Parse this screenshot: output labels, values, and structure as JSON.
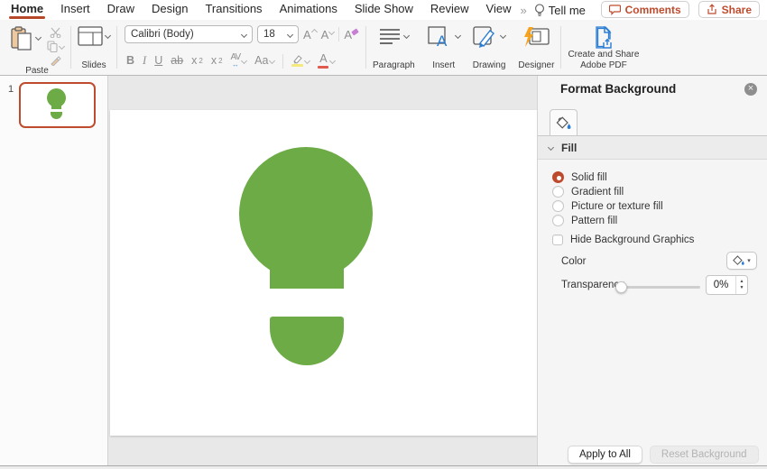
{
  "menubar": {
    "tabs": [
      "Home",
      "Insert",
      "Draw",
      "Design",
      "Transitions",
      "Animations",
      "Slide Show",
      "Review",
      "View"
    ],
    "overflow_glyph": "»",
    "tellme_label": "Tell me",
    "comments_label": "Comments",
    "share_label": "Share"
  },
  "ribbon": {
    "paste_label": "Paste",
    "slides_label": "Slides",
    "font_name": "Calibri (Body)",
    "font_size": "18",
    "increase_font": "A",
    "decrease_font": "A",
    "clear_format": "A",
    "bold": "B",
    "italic": "I",
    "underline": "U",
    "strikethrough": "ab",
    "superscript_base": "x",
    "superscript_mark": "2",
    "subscript_base": "x",
    "subscript_mark": "2",
    "char_spacing": "AV",
    "char_spacing_arrow": "↔",
    "change_case": "Aa",
    "font_color": "A",
    "paragraph_label": "Paragraph",
    "insert_label": "Insert",
    "drawing_label": "Drawing",
    "designer_label": "Designer",
    "adobe_label_line1": "Create and Share",
    "adobe_label_line2": "Adobe PDF"
  },
  "slides_panel": {
    "slide_number": "1"
  },
  "format_panel": {
    "title": "Format Background",
    "close_glyph": "×",
    "fill_section_label": "Fill",
    "fill_options": [
      "Solid fill",
      "Gradient fill",
      "Picture or texture fill",
      "Pattern fill"
    ],
    "selected_option": "Solid fill",
    "hide_bg_label": "Hide Background Graphics",
    "color_label": "Color",
    "color_dropdown_glyph": "▾",
    "transparency_label": "Transparency",
    "transparency_value": "0%",
    "stepper_up_glyph": "▲",
    "stepper_down_glyph": "▼",
    "apply_all_label": "Apply to All",
    "reset_label": "Reset Background"
  },
  "colors": {
    "accent_red": "#b5472a",
    "bulb_green": "#6cab45",
    "office_blue": "#2b7cd3"
  }
}
